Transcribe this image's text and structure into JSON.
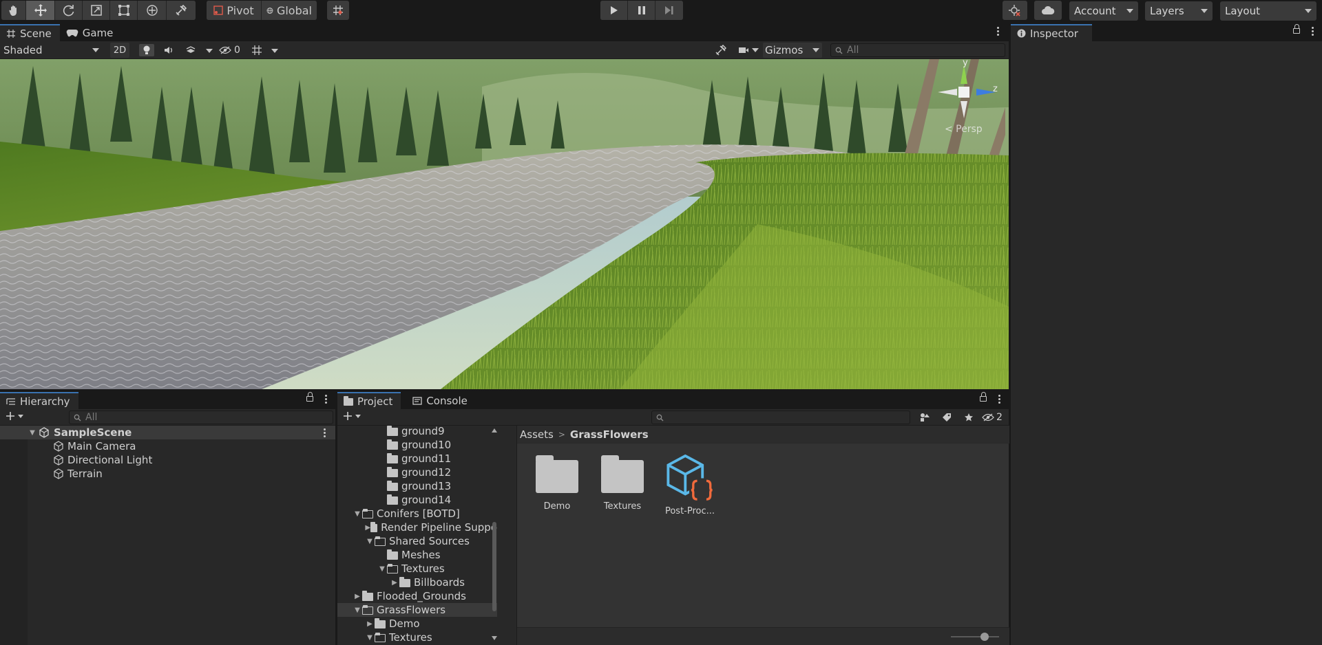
{
  "toolbar": {
    "tools": [
      "hand-tool",
      "move-tool",
      "rotate-tool",
      "scale-tool",
      "rect-tool",
      "transform-tool",
      "custom-tool"
    ],
    "pivot_label": "Pivot",
    "global_label": "Global",
    "account_label": "Account",
    "layers_label": "Layers",
    "layout_label": "Layout"
  },
  "scene": {
    "tabs": [
      "Scene",
      "Game"
    ],
    "shading_mode": "Shaded",
    "mode_2d_label": "2D",
    "hidden_count": "0",
    "gizmos_label": "Gizmos",
    "search_placeholder": "All",
    "gizmo_axis_y": "y",
    "gizmo_axis_z": "z",
    "projection_label": "< Persp"
  },
  "inspector": {
    "title": "Inspector"
  },
  "hierarchy": {
    "title": "Hierarchy",
    "search_placeholder": "All",
    "scene_name": "SampleScene",
    "objects": [
      "Main Camera",
      "Directional Light",
      "Terrain"
    ]
  },
  "project": {
    "tabs": [
      "Project",
      "Console"
    ],
    "hidden_count": "2",
    "tree": [
      {
        "label": "ground9",
        "depth": 3,
        "state": "none"
      },
      {
        "label": "ground10",
        "depth": 3,
        "state": "none"
      },
      {
        "label": "ground11",
        "depth": 3,
        "state": "none"
      },
      {
        "label": "ground12",
        "depth": 3,
        "state": "none"
      },
      {
        "label": "ground13",
        "depth": 3,
        "state": "none"
      },
      {
        "label": "ground14",
        "depth": 3,
        "state": "none"
      },
      {
        "label": "Conifers [BOTD]",
        "depth": 1,
        "state": "open"
      },
      {
        "label": "Render Pipeline Suppo",
        "depth": 2,
        "state": "closed"
      },
      {
        "label": "Shared Sources",
        "depth": 2,
        "state": "open"
      },
      {
        "label": "Meshes",
        "depth": 3,
        "state": "none"
      },
      {
        "label": "Textures",
        "depth": 3,
        "state": "open"
      },
      {
        "label": "Billboards",
        "depth": 4,
        "state": "closed"
      },
      {
        "label": "Flooded_Grounds",
        "depth": 1,
        "state": "closed"
      },
      {
        "label": "GrassFlowers",
        "depth": 1,
        "state": "open",
        "selected": true
      },
      {
        "label": "Demo",
        "depth": 2,
        "state": "closed"
      },
      {
        "label": "Textures",
        "depth": 2,
        "state": "open"
      }
    ],
    "breadcrumb": [
      "Assets",
      "GrassFlowers"
    ],
    "assets": [
      {
        "label": "Demo",
        "kind": "folder"
      },
      {
        "label": "Textures",
        "kind": "folder"
      },
      {
        "label": "Post-Proc...",
        "kind": "script-asset"
      }
    ],
    "zoom_slider": 0.7
  },
  "colors": {
    "accent_tab": "#3a72b0",
    "gizmo_y": "#8fd14f",
    "gizmo_z": "#3d7de0",
    "asset_cube": "#5ab8e8",
    "asset_braces": "#f06a3c"
  }
}
